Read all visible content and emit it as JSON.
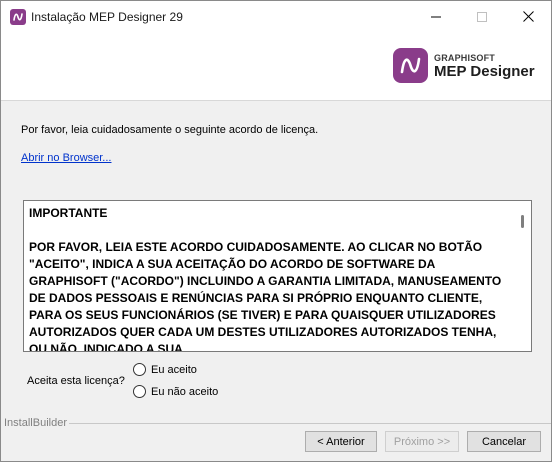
{
  "window": {
    "title": "Instalação MEP Designer 29"
  },
  "header": {
    "brand_small": "GRAPHISOFT",
    "brand_big": "MEP Designer"
  },
  "intro": "Por favor, leia cuidadosamente o seguinte acordo de licença.",
  "browser_link": "Abrir no Browser...",
  "license": {
    "heading": "IMPORTANTE",
    "body": "POR FAVOR, LEIA ESTE ACORDO CUIDADOSAMENTE. AO CLICAR NO BOTÃO \"ACEITO\", INDICA A SUA ACEITAÇÃO DO ACORDO DE SOFTWARE DA GRAPHISOFT (\"ACORDO\") INCLUINDO A GARANTIA LIMITADA, MANUSEAMENTO DE DADOS PESSOAIS E RENÚNCIAS PARA SI PRÓPRIO ENQUANTO CLIENTE, PARA OS SEUS FUNCIONÁRIOS (SE TIVER) E PARA QUAISQUER UTILIZADORES AUTORIZADOS QUER CADA UM DESTES UTILIZADORES AUTORIZADOS TENHA, OU NÃO, INDICADO A SUA"
  },
  "acceptance": {
    "question": "Aceita esta licença?",
    "accept_label": "Eu aceito",
    "decline_label": "Eu não aceito"
  },
  "footer": {
    "installer_brand": "InstallBuilder",
    "back_label": "< Anterior",
    "next_label": "Próximo >>",
    "cancel_label": "Cancelar"
  }
}
